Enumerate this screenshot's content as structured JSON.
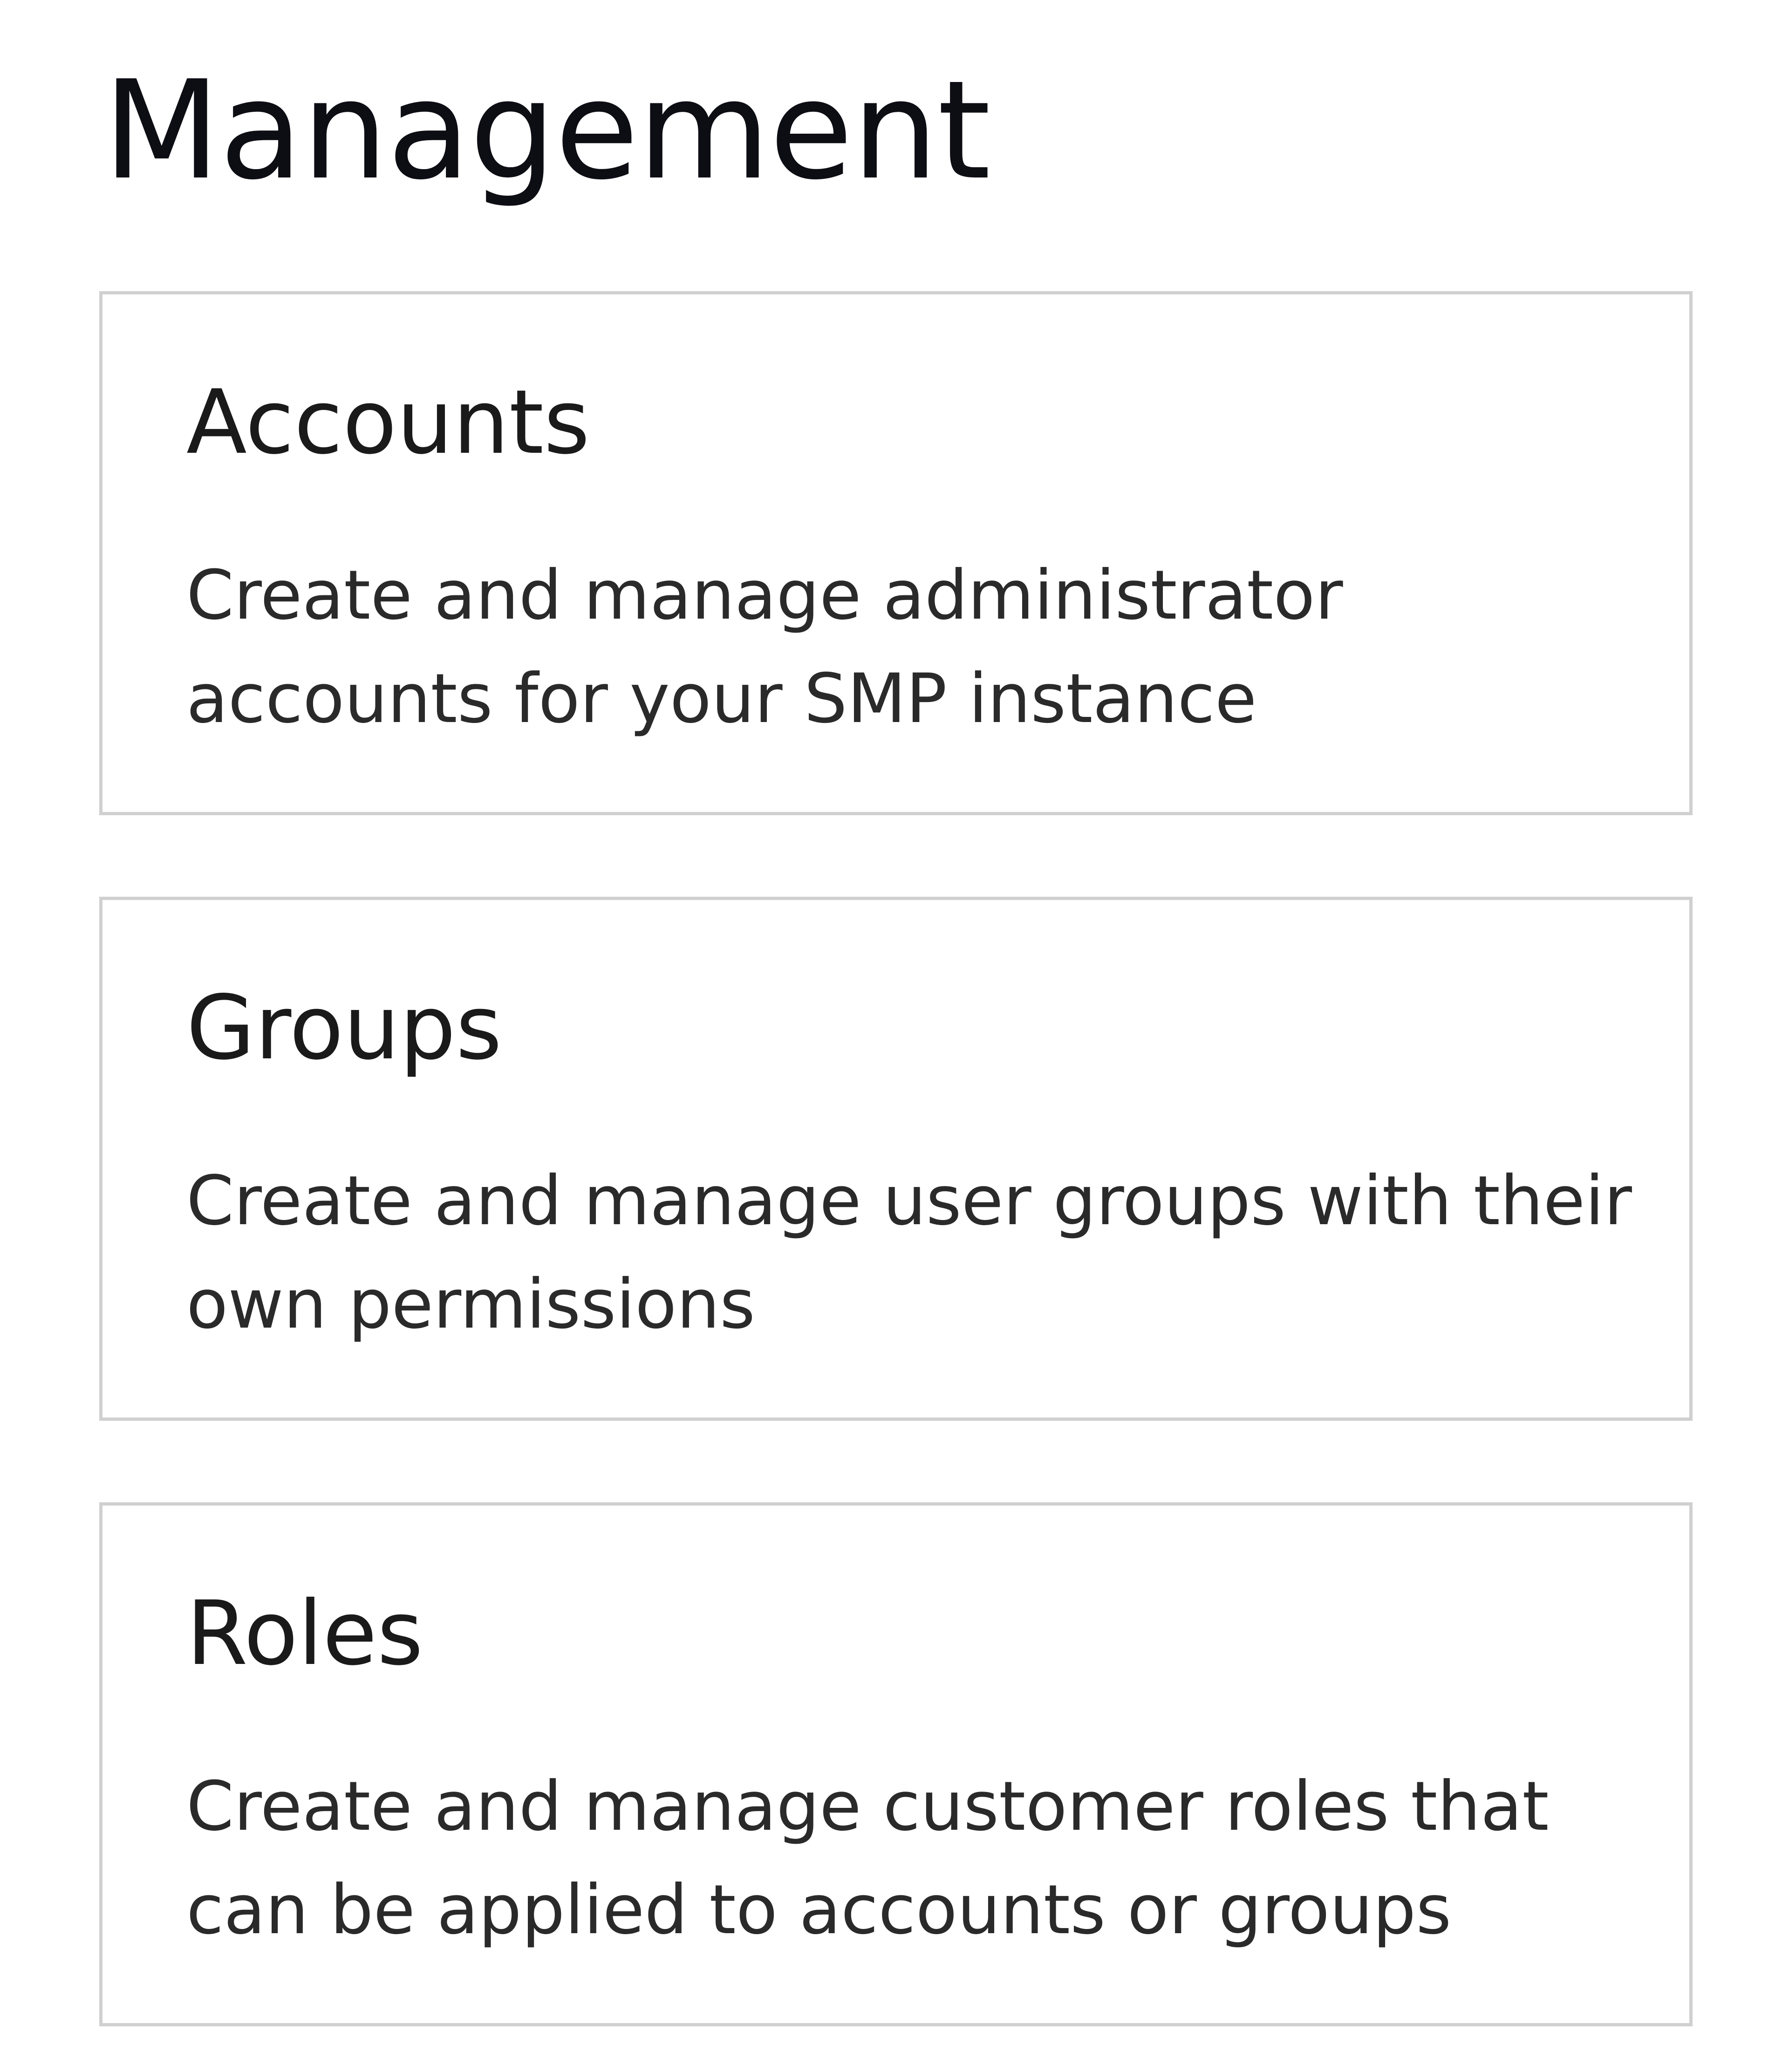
{
  "page": {
    "title": "Management"
  },
  "cards": [
    {
      "title": "Accounts",
      "line1": "Create and manage administrator",
      "line2": "accounts for your SMP instance"
    },
    {
      "title": "Groups",
      "line1": "Create and manage user groups with their",
      "line2": "own permissions"
    },
    {
      "title": "Roles",
      "line1": "Create and manage customer roles that",
      "line2": "can be applied to accounts or groups"
    }
  ]
}
